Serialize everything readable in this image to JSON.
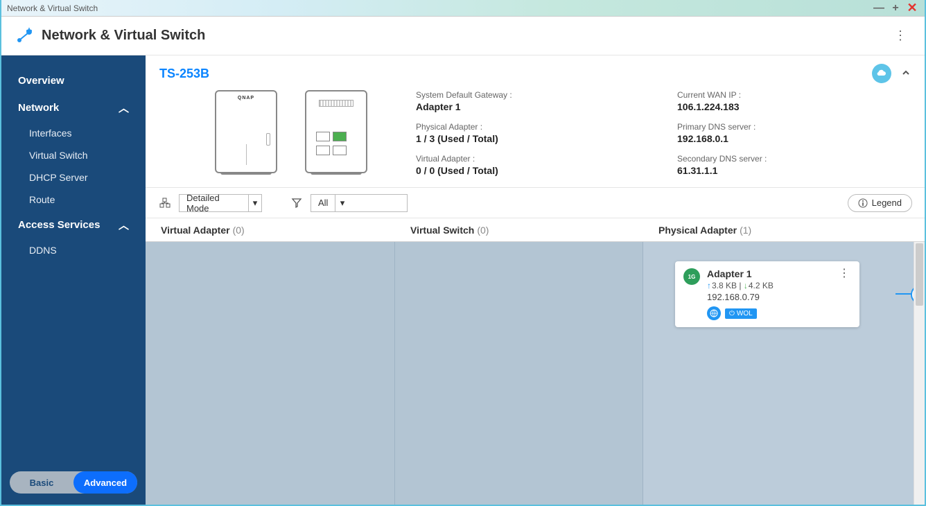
{
  "window": {
    "title": "Network & Virtual Switch"
  },
  "header": {
    "title": "Network & Virtual Switch"
  },
  "sidebar": {
    "overview": "Overview",
    "network": "Network",
    "interfaces": "Interfaces",
    "virtual_switch": "Virtual Switch",
    "dhcp_server": "DHCP Server",
    "route": "Route",
    "access_services": "Access Services",
    "ddns": "DDNS",
    "mode_basic": "Basic",
    "mode_advanced": "Advanced"
  },
  "device": {
    "name": "TS-253B",
    "brand": "QNAP",
    "info": {
      "gateway_label": "System Default Gateway :",
      "gateway_value": "Adapter 1",
      "wan_label": "Current WAN IP :",
      "wan_value": "106.1.224.183",
      "physical_label": "Physical Adapter :",
      "physical_value": "1 / 3 (Used / Total)",
      "dns1_label": "Primary DNS server :",
      "dns1_value": "192.168.0.1",
      "virtual_label": "Virtual Adapter :",
      "virtual_value": "0 / 0 (Used / Total)",
      "dns2_label": "Secondary DNS server :",
      "dns2_value": "61.31.1.1"
    }
  },
  "toolbar": {
    "mode": "Detailed Mode",
    "filter": "All",
    "legend": "Legend"
  },
  "columns": {
    "va_label": "Virtual Adapter",
    "va_count": "(0)",
    "vs_label": "Virtual Switch",
    "vs_count": "(0)",
    "pa_label": "Physical Adapter",
    "pa_count": "(1)"
  },
  "adapter": {
    "speed": "1G",
    "name": "Adapter 1",
    "up": "3.8 KB",
    "sep": " | ",
    "down": "4.2 KB",
    "ip": "192.168.0.79",
    "wol": "WOL"
  }
}
